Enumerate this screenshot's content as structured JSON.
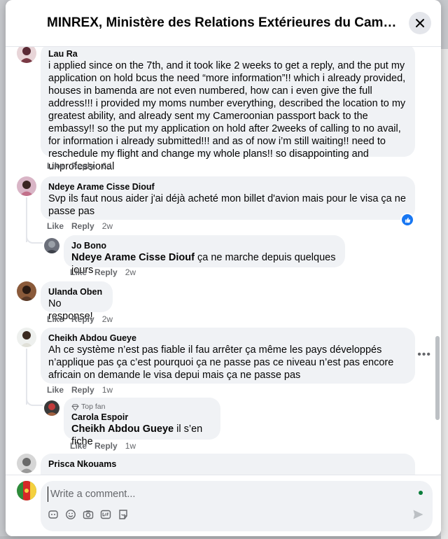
{
  "dialog": {
    "title": "MINREX, Ministère des Relations Extérieures du Cameroun..."
  },
  "actions": {
    "like": "Like",
    "reply": "Reply"
  },
  "comments": [
    {
      "author": "Lau Ra",
      "text": "i applied since on the 7th, and it took like 2 weeks to get a reply, and the put my application on hold bcus the need “more information”!! which i already provided, houses in bamenda are not even numbered, how can i even give the full address!!! i provided my moms number everything, described the location to my greatest ability, and already sent my Cameroonian passport back to the embassy!! so the put my application on hold after 2weeks of calling to no avail, for information i already submitted!!! and as of now i’m still waiting!! need to reschedule my flight and change my whole plans!! so disappointing and unprofessional",
      "time": "6d"
    },
    {
      "author": "Ndeye Arame Cisse Diouf",
      "text": "Svp ils faut nous aider j'ai déjà acheté mon billet d'avion mais pour le visa ça ne passe pas",
      "time": "2w",
      "reaction": "like"
    },
    {
      "author": "Jo Bono",
      "mention": "Ndeye Arame Cisse Diouf",
      "text": " ça ne marche depuis quelques jours",
      "time": "2w"
    },
    {
      "author": "Ulanda Oben",
      "text": "No response!",
      "time": "2w"
    },
    {
      "author": "Cheikh Abdou Gueye",
      "text": "Ah ce système n’est pas fiable il fau arrêter ça même les pays développés n’applique pas ça c’est pourquoi ça ne passe pas ce niveau n’est pas encore africain on demande le visa depui mais ça ne passe pas",
      "time": "1w"
    },
    {
      "author": "Carola Espoir",
      "badge": "Top fan",
      "mention": "Cheikh Abdou Gueye",
      "text": " il s’en fiche",
      "time": "1w"
    },
    {
      "author": "Prisca Nkouams",
      "text": ""
    }
  ],
  "composer": {
    "placeholder": "Write a comment..."
  },
  "icons": {
    "close": "close-icon",
    "like_reaction": "thumbs-up-icon",
    "more": "more-options-icon",
    "top_fan": "diamond-icon",
    "tools": [
      "sticker-icon",
      "emoji-icon",
      "camera-icon",
      "gif-icon",
      "avatar-sticker-icon"
    ],
    "send": "send-icon"
  },
  "colors": {
    "accent": "#1877f2",
    "bubble": "#f0f2f5",
    "meta": "#65676b"
  }
}
